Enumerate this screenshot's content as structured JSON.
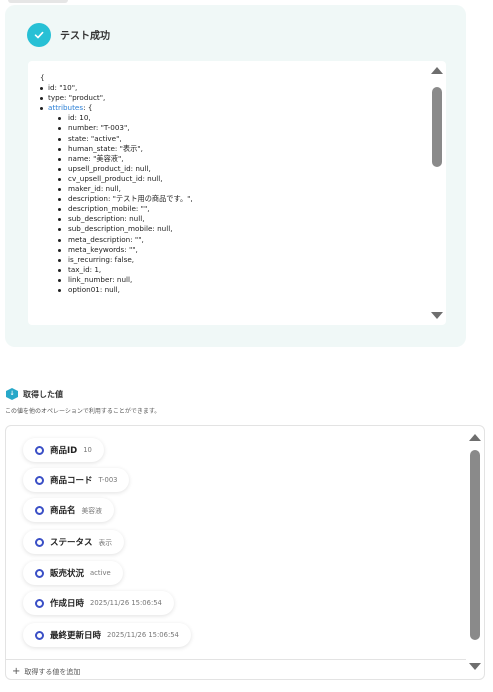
{
  "test_result": {
    "title": "テスト成功",
    "json_lines": [
      {
        "level": 0,
        "bullet": false,
        "key": "",
        "text": "{"
      },
      {
        "level": 1,
        "bullet": true,
        "key": "",
        "text": "id: \"10\","
      },
      {
        "level": 1,
        "bullet": true,
        "key": "",
        "text": "type: \"product\","
      },
      {
        "level": 1,
        "bullet": true,
        "key": "attributes",
        "text": ": {"
      },
      {
        "level": 2,
        "bullet": true,
        "key": "",
        "text": "id: 10,"
      },
      {
        "level": 2,
        "bullet": true,
        "key": "",
        "text": "number: \"T-003\","
      },
      {
        "level": 2,
        "bullet": true,
        "key": "",
        "text": "state: \"active\","
      },
      {
        "level": 2,
        "bullet": true,
        "key": "",
        "text": "human_state: \"表示\","
      },
      {
        "level": 2,
        "bullet": true,
        "key": "",
        "text": "name: \"美容液\","
      },
      {
        "level": 2,
        "bullet": true,
        "key": "",
        "text": "upsell_product_id: null,"
      },
      {
        "level": 2,
        "bullet": true,
        "key": "",
        "text": "cv_upsell_product_id: null,"
      },
      {
        "level": 2,
        "bullet": true,
        "key": "",
        "text": "maker_id: null,"
      },
      {
        "level": 2,
        "bullet": true,
        "key": "",
        "text": "description: \"テスト用の商品です。\","
      },
      {
        "level": 2,
        "bullet": true,
        "key": "",
        "text": "description_mobile: \"\","
      },
      {
        "level": 2,
        "bullet": true,
        "key": "",
        "text": "sub_description: null,"
      },
      {
        "level": 2,
        "bullet": true,
        "key": "",
        "text": "sub_description_mobile: null,"
      },
      {
        "level": 2,
        "bullet": true,
        "key": "",
        "text": "meta_description: \"\","
      },
      {
        "level": 2,
        "bullet": true,
        "key": "",
        "text": "meta_keywords: \"\","
      },
      {
        "level": 2,
        "bullet": true,
        "key": "",
        "text": "is_recurring: false,"
      },
      {
        "level": 2,
        "bullet": true,
        "key": "",
        "text": "tax_id: 1,"
      },
      {
        "level": 2,
        "bullet": true,
        "key": "",
        "text": "link_number: null,"
      },
      {
        "level": 2,
        "bullet": true,
        "key": "",
        "text": "option01: null,"
      }
    ]
  },
  "captured": {
    "title": "取得した値",
    "description": "この値を他のオペレーションで利用することができます。",
    "items": [
      {
        "label": "商品ID",
        "value": "10"
      },
      {
        "label": "商品コード",
        "value": "T-003"
      },
      {
        "label": "商品名",
        "value": "美容液"
      },
      {
        "label": "ステータス",
        "value": "表示"
      },
      {
        "label": "販売状況",
        "value": "active"
      },
      {
        "label": "作成日時",
        "value": "2025/11/26 15:06:54"
      },
      {
        "label": "最終更新日時",
        "value": "2025/11/26 15:06:54"
      }
    ],
    "add_label": "取得する値を追加"
  },
  "colors": {
    "accent": "#27c0d5",
    "panel_bg": "#f0f8f7",
    "ring": "#3a4fc6",
    "attr_key": "#2a7fd6"
  },
  "icons": {
    "success": "check-circle-icon",
    "captured": "hexagon-badge-icon",
    "item": "ring-icon",
    "add": "plus-icon"
  }
}
